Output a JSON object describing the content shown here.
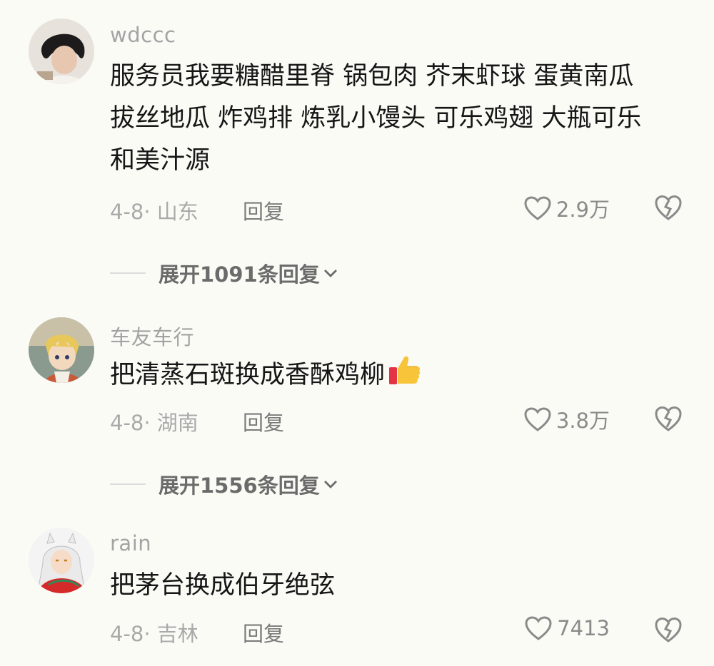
{
  "comments": [
    {
      "username": "wdccc",
      "lines": [
        "服务员我要糖醋里脊 锅包肉 芥末虾球 蛋黄南瓜",
        "拔丝地瓜 炸鸡排 炼乳小馒头 可乐鸡翅 大瓶可乐",
        "和美汁源"
      ],
      "date_location": "4-8· 山东",
      "reply_label": "回复",
      "likes": "2.9万",
      "expand_label": "展开1091条回复"
    },
    {
      "username": "车友车行",
      "lines": [
        "把清蒸石斑换成香酥鸡柳"
      ],
      "emoji": "thumbs-up",
      "date_location": "4-8· 湖南",
      "reply_label": "回复",
      "likes": "3.8万",
      "expand_label": "展开1556条回复"
    },
    {
      "username": "rain",
      "lines": [
        "把茅台换成伯牙绝弦"
      ],
      "date_location": "4-8· 吉林",
      "reply_label": "回复",
      "likes": "7413"
    }
  ],
  "icons": {
    "like": "heart-outline-icon",
    "dislike": "broken-heart-icon",
    "expand": "chevron-down-icon"
  },
  "colors": {
    "background": "#fbfbf6",
    "text": "#161616",
    "muted": "#a3a3a3"
  }
}
